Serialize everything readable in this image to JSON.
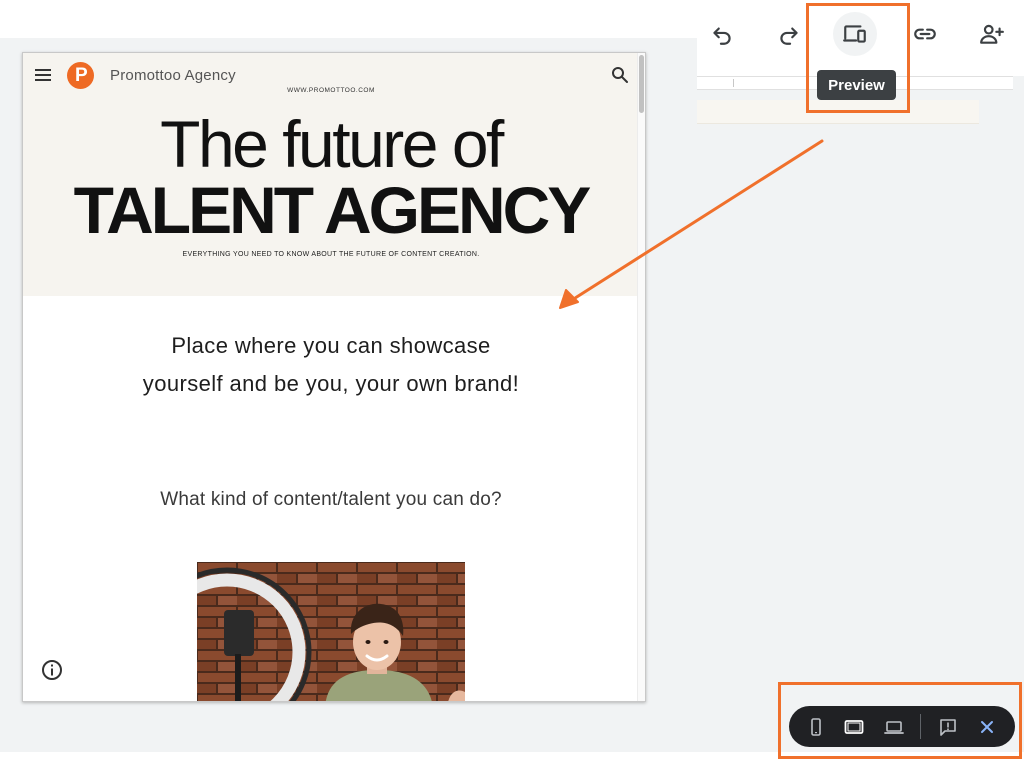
{
  "toolbar": {
    "buttons": [
      {
        "name": "undo",
        "icon": "undo-icon"
      },
      {
        "name": "redo",
        "icon": "redo-icon"
      },
      {
        "name": "preview",
        "icon": "devices-icon"
      },
      {
        "name": "copy-link",
        "icon": "link-icon"
      },
      {
        "name": "share",
        "icon": "add-person-icon"
      }
    ],
    "tooltip": "Preview"
  },
  "site": {
    "name": "Promottoo Agency",
    "logo_letter": "P",
    "url": "WWW.PROMOTTOO.COM",
    "hero_line1": "The future of",
    "hero_line2": "TALENT AGENCY",
    "hero_sub": "EVERYTHING YOU NEED TO KNOW ABOUT THE FUTURE OF CONTENT CREATION.",
    "tagline": "Place where you can showcase yourself and be you, your own brand!",
    "question": "What kind of content/talent you can do?"
  },
  "device_bar": {
    "buttons": [
      {
        "name": "phone-view",
        "icon": "phone-icon"
      },
      {
        "name": "tablet-view",
        "icon": "tablet-icon",
        "selected": true
      },
      {
        "name": "desktop-view",
        "icon": "laptop-icon"
      },
      {
        "name": "feedback",
        "icon": "feedback-icon"
      },
      {
        "name": "close-preview",
        "icon": "close-icon"
      }
    ]
  },
  "colors": {
    "accent": "#f0702b",
    "brand": "#ee6a24",
    "hero_bg": "#f6f4ef",
    "workspace_bg": "#f1f3f4",
    "device_bar_bg": "#202124",
    "close_blue": "#8ab4f8"
  }
}
